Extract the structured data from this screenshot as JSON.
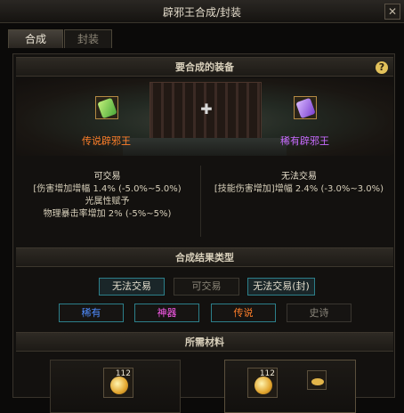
{
  "window": {
    "title": "辟邪王合成/封装",
    "close_icon": "close-icon"
  },
  "tabs": [
    {
      "label": "合成",
      "active": true
    },
    {
      "label": "封装",
      "active": false
    }
  ],
  "equip_section": {
    "header": "要合成的装备",
    "help_icon": "?"
  },
  "items": {
    "left": {
      "name": "传说辟邪王",
      "color": "#ff7f2a",
      "trade": "可交易",
      "stats": [
        "[伤害增加增幅 1.4% (-5.0%~5.0%)",
        "光属性赋予",
        "物理暴击率增加 2% (-5%~5%)"
      ]
    },
    "right": {
      "name": "稀有辟邪王",
      "color": "#c86bff",
      "trade": "无法交易",
      "stats": [
        "[技能伤害增加]增幅 2.4% (-3.0%~3.0%)"
      ]
    }
  },
  "result_section": {
    "header": "合成结果类型",
    "trade_options": [
      {
        "label": "无法交易",
        "selected": true
      },
      {
        "label": "可交易",
        "selected": false
      },
      {
        "label": "无法交易(封)",
        "selected": true
      }
    ],
    "rarity_options": [
      {
        "label": "稀有",
        "color": "#4f8cff",
        "selected": true
      },
      {
        "label": "神器",
        "color": "#ff5cf0",
        "selected": true
      },
      {
        "label": "传说",
        "color": "#ff7f2a",
        "selected": true
      },
      {
        "label": "史诗",
        "color": "#8a857a",
        "selected": false
      }
    ]
  },
  "materials_section": {
    "header": "所需材料",
    "left_count": "112",
    "right_count": "112"
  }
}
